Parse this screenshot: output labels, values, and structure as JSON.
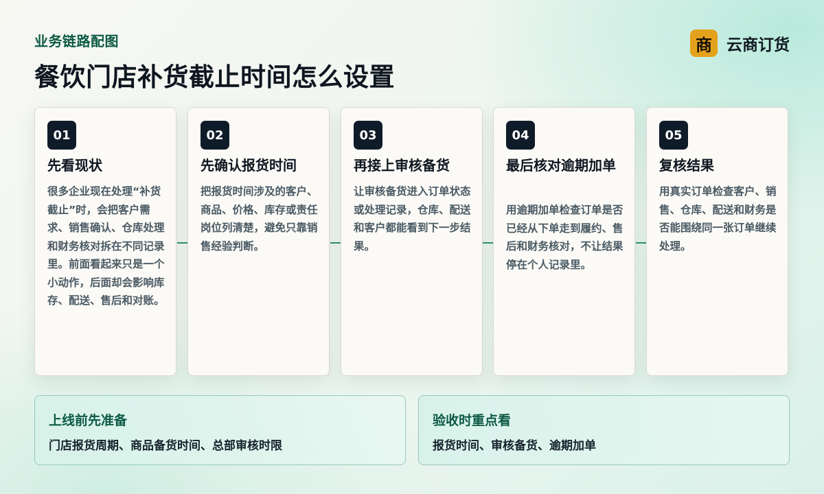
{
  "header": {
    "eyebrow": "业务链路配图",
    "title": "餐饮门店补货截止时间怎么设置"
  },
  "brand": {
    "logo_text": "商",
    "name": "云商订货"
  },
  "steps": [
    {
      "number": "01",
      "title": "先看现状",
      "desc": "很多企业现在处理“补货截止”时，会把客户需求、销售确认、仓库处理和财务核对拆在不同记录里。前面看起来只是一个小动作，后面却会影响库存、配送、售后和对账。"
    },
    {
      "number": "02",
      "title": "先确认报货时间",
      "desc": "把报货时间涉及的客户、商品、价格、库存或责任岗位列清楚，避免只靠销售经验判断。"
    },
    {
      "number": "03",
      "title": "再接上审核备货",
      "desc": "让审核备货进入订单状态或处理记录，仓库、配送和客户都能看到下一步结果。"
    },
    {
      "number": "04",
      "title": "最后核对逾期加单",
      "desc": "用逾期加单检查订单是否已经从下单走到履约、售后和财务核对，不让结果停在个人记录里。"
    },
    {
      "number": "05",
      "title": "复核结果",
      "desc": "用真实订单检查客户、销售、仓库、配送和财务是否能围绕同一张订单继续处理。"
    }
  ],
  "notes": [
    {
      "title": "上线前先准备",
      "desc": "门店报货周期、商品备货时间、总部审核时限"
    },
    {
      "title": "验收时重点看",
      "desc": "报货时间、审核备货、逾期加单"
    }
  ],
  "colors": {
    "accent": "#0d5a45",
    "badge": "#0f1b28",
    "brand_logo": "#e4a21c",
    "connector": "#2e8f74"
  }
}
